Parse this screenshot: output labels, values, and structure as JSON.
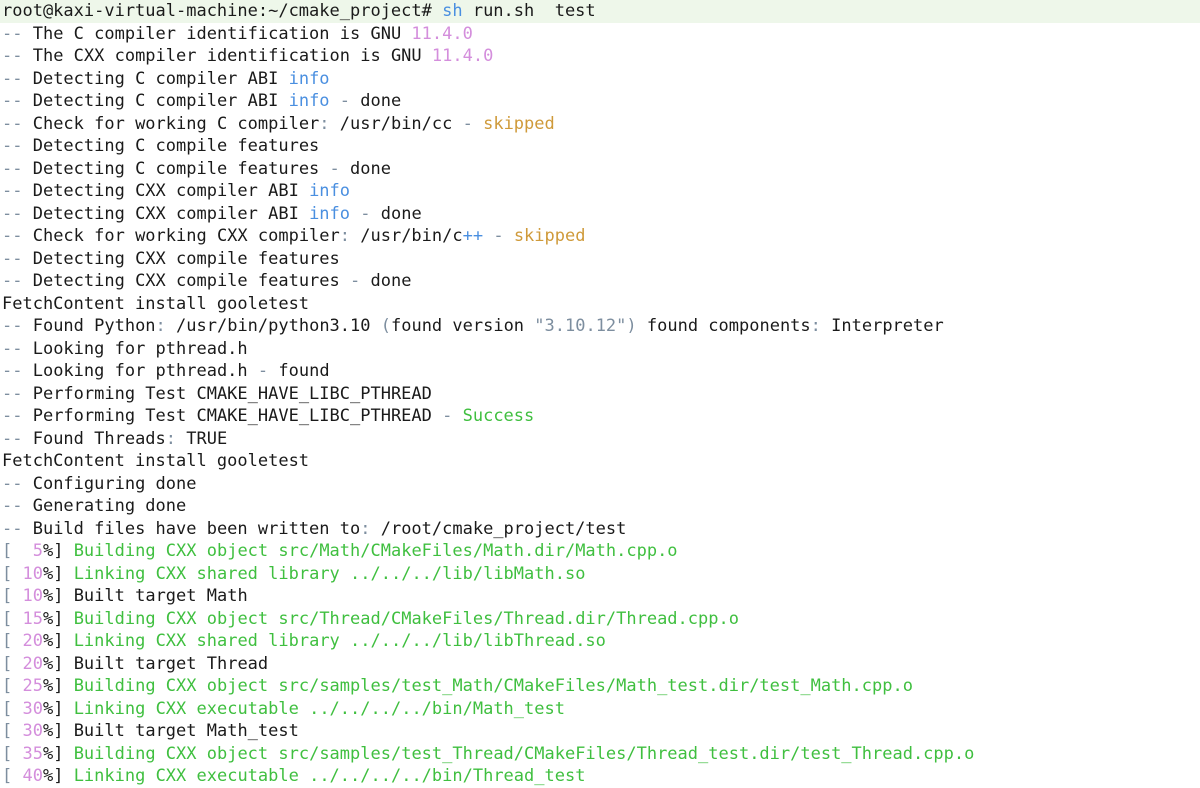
{
  "terminal": {
    "colors": {
      "default": "#1a1a1a",
      "dim": "#7d8e9f",
      "blue": "#4a8fe0",
      "pink": "#d48edc",
      "orange": "#cf9a3a",
      "green": "#3fbf3f",
      "prompt_bg": "#eef7ea"
    },
    "lines": [
      {
        "hl": true,
        "segs": [
          {
            "t": "root@kaxi-virtual-machine:~/cmake_project# ",
            "c": "default"
          },
          {
            "t": "sh",
            "c": "blue"
          },
          {
            "t": " run.sh  test",
            "c": "default"
          }
        ]
      },
      {
        "segs": [
          {
            "t": "-- ",
            "c": "dim"
          },
          {
            "t": "The C compiler identification is GNU ",
            "c": "default"
          },
          {
            "t": "11.4.0",
            "c": "pink"
          }
        ]
      },
      {
        "segs": [
          {
            "t": "-- ",
            "c": "dim"
          },
          {
            "t": "The CXX compiler identification is GNU ",
            "c": "default"
          },
          {
            "t": "11.4.0",
            "c": "pink"
          }
        ]
      },
      {
        "segs": [
          {
            "t": "-- ",
            "c": "dim"
          },
          {
            "t": "Detecting C compiler ABI ",
            "c": "default"
          },
          {
            "t": "info",
            "c": "blue"
          }
        ]
      },
      {
        "segs": [
          {
            "t": "-- ",
            "c": "dim"
          },
          {
            "t": "Detecting C compiler ABI ",
            "c": "default"
          },
          {
            "t": "info",
            "c": "blue"
          },
          {
            "t": " - ",
            "c": "dim"
          },
          {
            "t": "done",
            "c": "default"
          }
        ]
      },
      {
        "segs": [
          {
            "t": "-- ",
            "c": "dim"
          },
          {
            "t": "Check for working C compiler",
            "c": "default"
          },
          {
            "t": ": ",
            "c": "dim"
          },
          {
            "t": "/usr/bin/cc",
            "c": "default"
          },
          {
            "t": " - ",
            "c": "dim"
          },
          {
            "t": "skipped",
            "c": "orange"
          }
        ]
      },
      {
        "segs": [
          {
            "t": "-- ",
            "c": "dim"
          },
          {
            "t": "Detecting C compile features",
            "c": "default"
          }
        ]
      },
      {
        "segs": [
          {
            "t": "-- ",
            "c": "dim"
          },
          {
            "t": "Detecting C compile features",
            "c": "default"
          },
          {
            "t": " - ",
            "c": "dim"
          },
          {
            "t": "done",
            "c": "default"
          }
        ]
      },
      {
        "segs": [
          {
            "t": "-- ",
            "c": "dim"
          },
          {
            "t": "Detecting CXX compiler ABI ",
            "c": "default"
          },
          {
            "t": "info",
            "c": "blue"
          }
        ]
      },
      {
        "segs": [
          {
            "t": "-- ",
            "c": "dim"
          },
          {
            "t": "Detecting CXX compiler ABI ",
            "c": "default"
          },
          {
            "t": "info",
            "c": "blue"
          },
          {
            "t": " - ",
            "c": "dim"
          },
          {
            "t": "done",
            "c": "default"
          }
        ]
      },
      {
        "segs": [
          {
            "t": "-- ",
            "c": "dim"
          },
          {
            "t": "Check for working CXX compiler",
            "c": "default"
          },
          {
            "t": ": ",
            "c": "dim"
          },
          {
            "t": "/usr/bin/c",
            "c": "default"
          },
          {
            "t": "++",
            "c": "blue"
          },
          {
            "t": " - ",
            "c": "dim"
          },
          {
            "t": "skipped",
            "c": "orange"
          }
        ]
      },
      {
        "segs": [
          {
            "t": "-- ",
            "c": "dim"
          },
          {
            "t": "Detecting CXX compile features",
            "c": "default"
          }
        ]
      },
      {
        "segs": [
          {
            "t": "-- ",
            "c": "dim"
          },
          {
            "t": "Detecting CXX compile features",
            "c": "default"
          },
          {
            "t": " - ",
            "c": "dim"
          },
          {
            "t": "done",
            "c": "default"
          }
        ]
      },
      {
        "segs": [
          {
            "t": "FetchContent install gooletest",
            "c": "default"
          }
        ]
      },
      {
        "segs": [
          {
            "t": "-- ",
            "c": "dim"
          },
          {
            "t": "Found Python",
            "c": "default"
          },
          {
            "t": ": ",
            "c": "dim"
          },
          {
            "t": "/usr/bin/python3.10 ",
            "c": "default"
          },
          {
            "t": "(",
            "c": "dim"
          },
          {
            "t": "found version ",
            "c": "default"
          },
          {
            "t": "\"3.10.12\"",
            "c": "dim"
          },
          {
            "t": ")",
            "c": "dim"
          },
          {
            "t": " found components",
            "c": "default"
          },
          {
            "t": ": ",
            "c": "dim"
          },
          {
            "t": "Interpreter",
            "c": "default"
          }
        ]
      },
      {
        "segs": [
          {
            "t": "-- ",
            "c": "dim"
          },
          {
            "t": "Looking for pthread.h",
            "c": "default"
          }
        ]
      },
      {
        "segs": [
          {
            "t": "-- ",
            "c": "dim"
          },
          {
            "t": "Looking for pthread.h",
            "c": "default"
          },
          {
            "t": " - ",
            "c": "dim"
          },
          {
            "t": "found",
            "c": "default"
          }
        ]
      },
      {
        "segs": [
          {
            "t": "-- ",
            "c": "dim"
          },
          {
            "t": "Performing Test CMAKE_HAVE_LIBC_PTHREAD",
            "c": "default"
          }
        ]
      },
      {
        "segs": [
          {
            "t": "-- ",
            "c": "dim"
          },
          {
            "t": "Performing Test CMAKE_HAVE_LIBC_PTHREAD",
            "c": "default"
          },
          {
            "t": " - ",
            "c": "dim"
          },
          {
            "t": "Success",
            "c": "green"
          }
        ]
      },
      {
        "segs": [
          {
            "t": "-- ",
            "c": "dim"
          },
          {
            "t": "Found Threads",
            "c": "default"
          },
          {
            "t": ": ",
            "c": "dim"
          },
          {
            "t": "TRUE",
            "c": "default"
          }
        ]
      },
      {
        "segs": [
          {
            "t": "FetchContent install gooletest",
            "c": "default"
          }
        ]
      },
      {
        "segs": [
          {
            "t": "-- ",
            "c": "dim"
          },
          {
            "t": "Configuring done",
            "c": "default"
          }
        ]
      },
      {
        "segs": [
          {
            "t": "-- ",
            "c": "dim"
          },
          {
            "t": "Generating done",
            "c": "default"
          }
        ]
      },
      {
        "segs": [
          {
            "t": "-- ",
            "c": "dim"
          },
          {
            "t": "Build files have been written to",
            "c": "default"
          },
          {
            "t": ": ",
            "c": "dim"
          },
          {
            "t": "/root/cmake_project/test",
            "c": "default"
          }
        ]
      },
      {
        "segs": [
          {
            "t": "[  ",
            "c": "dim"
          },
          {
            "t": "5",
            "c": "pink"
          },
          {
            "t": "%] ",
            "c": "default"
          },
          {
            "t": "Building CXX object src/Math/CMakeFiles/Math.dir/Math.cpp.o",
            "c": "green"
          }
        ]
      },
      {
        "segs": [
          {
            "t": "[ ",
            "c": "dim"
          },
          {
            "t": "10",
            "c": "pink"
          },
          {
            "t": "%] ",
            "c": "default"
          },
          {
            "t": "Linking CXX shared library ../../../lib/libMath.so",
            "c": "green"
          }
        ]
      },
      {
        "segs": [
          {
            "t": "[ ",
            "c": "dim"
          },
          {
            "t": "10",
            "c": "pink"
          },
          {
            "t": "%] ",
            "c": "default"
          },
          {
            "t": "Built target Math",
            "c": "default"
          }
        ]
      },
      {
        "segs": [
          {
            "t": "[ ",
            "c": "dim"
          },
          {
            "t": "15",
            "c": "pink"
          },
          {
            "t": "%] ",
            "c": "default"
          },
          {
            "t": "Building CXX object src/Thread/CMakeFiles/Thread.dir/Thread.cpp.o",
            "c": "green"
          }
        ]
      },
      {
        "segs": [
          {
            "t": "[ ",
            "c": "dim"
          },
          {
            "t": "20",
            "c": "pink"
          },
          {
            "t": "%] ",
            "c": "default"
          },
          {
            "t": "Linking CXX shared library ../../../lib/libThread.so",
            "c": "green"
          }
        ]
      },
      {
        "segs": [
          {
            "t": "[ ",
            "c": "dim"
          },
          {
            "t": "20",
            "c": "pink"
          },
          {
            "t": "%] ",
            "c": "default"
          },
          {
            "t": "Built target Thread",
            "c": "default"
          }
        ]
      },
      {
        "segs": [
          {
            "t": "[ ",
            "c": "dim"
          },
          {
            "t": "25",
            "c": "pink"
          },
          {
            "t": "%] ",
            "c": "default"
          },
          {
            "t": "Building CXX object src/samples/test_Math/CMakeFiles/Math_test.dir/test_Math.cpp.o",
            "c": "green"
          }
        ]
      },
      {
        "segs": [
          {
            "t": "[ ",
            "c": "dim"
          },
          {
            "t": "30",
            "c": "pink"
          },
          {
            "t": "%] ",
            "c": "default"
          },
          {
            "t": "Linking CXX executable ../../../../bin/Math_test",
            "c": "green"
          }
        ]
      },
      {
        "segs": [
          {
            "t": "[ ",
            "c": "dim"
          },
          {
            "t": "30",
            "c": "pink"
          },
          {
            "t": "%] ",
            "c": "default"
          },
          {
            "t": "Built target Math_test",
            "c": "default"
          }
        ]
      },
      {
        "segs": [
          {
            "t": "[ ",
            "c": "dim"
          },
          {
            "t": "35",
            "c": "pink"
          },
          {
            "t": "%] ",
            "c": "default"
          },
          {
            "t": "Building CXX object src/samples/test_Thread/CMakeFiles/Thread_test.dir/test_Thread.cpp.o",
            "c": "green"
          }
        ]
      },
      {
        "segs": [
          {
            "t": "[ ",
            "c": "dim"
          },
          {
            "t": "40",
            "c": "pink"
          },
          {
            "t": "%] ",
            "c": "default"
          },
          {
            "t": "Linking CXX executable ../../../../bin/Thread_test",
            "c": "green"
          }
        ]
      }
    ]
  }
}
